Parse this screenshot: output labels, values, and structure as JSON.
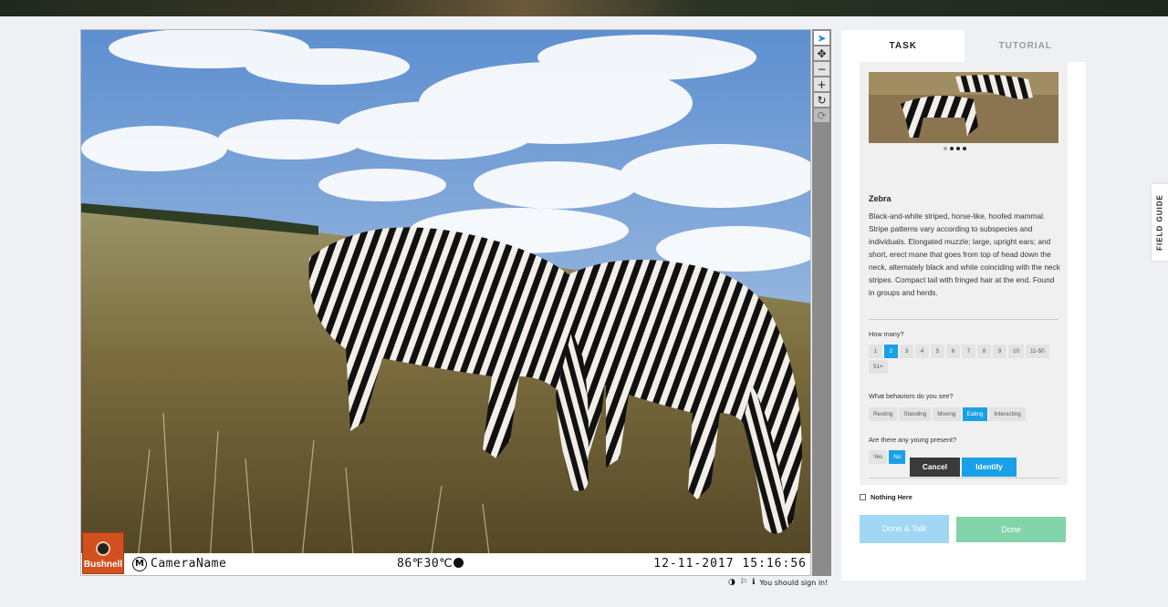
{
  "subject": {
    "camera": {
      "brand": "Bushnell",
      "name": "CameraName",
      "temperature": "86℉30℃",
      "datetime": "12-11-2017 15:16:56"
    }
  },
  "toolbar": {
    "icons": [
      "pointer-icon",
      "pan-icon",
      "zoom-out-icon",
      "zoom-in-icon",
      "rotate-icon",
      "reset-icon"
    ],
    "glyphs": [
      "➤",
      "✥",
      "−",
      "+",
      "↻",
      "⟳"
    ]
  },
  "meta": {
    "sign_in_text": "You should sign in!"
  },
  "tabs": {
    "task": "TASK",
    "tutorial": "TUTORIAL"
  },
  "field_guide": {
    "label": "FIELD GUIDE"
  },
  "task": {
    "species_name": "Zebra",
    "species_description": "Black-and-white striped, horse-like, hoofed mammal. Stripe patterns vary according to subspecies and individuals. Elongated muzzle; large, upright ears; and short, erect mane that goes from top of head down the neck, alternately black and white coinciding with the neck stripes. Compact tail with fringed hair at the end. Found in groups and herds.",
    "carousel_active_index": 1,
    "carousel_count": 4,
    "how_many": {
      "question": "How many?",
      "options": [
        "1",
        "2",
        "3",
        "4",
        "5",
        "6",
        "7",
        "8",
        "9",
        "10",
        "11-50",
        "51+"
      ],
      "selected": "2"
    },
    "behaviors": {
      "question": "What behaviors do you see?",
      "options": [
        "Resting",
        "Standing",
        "Moving",
        "Eating",
        "Interacting"
      ],
      "selected": "Eating"
    },
    "young": {
      "question": "Are there any young present?",
      "options": [
        "Yes",
        "No"
      ],
      "selected": "No"
    },
    "cancel_label": "Cancel",
    "identify_label": "Identify"
  },
  "footer": {
    "nothing_here_label": "Nothing Here",
    "done_talk_label": "Done & Talk",
    "done_label": "Done"
  },
  "colors": {
    "accent": "#1aa0e8",
    "done": "#82d4a9",
    "done_talk": "#9fd7f5",
    "cancel": "#3a3a3a"
  }
}
